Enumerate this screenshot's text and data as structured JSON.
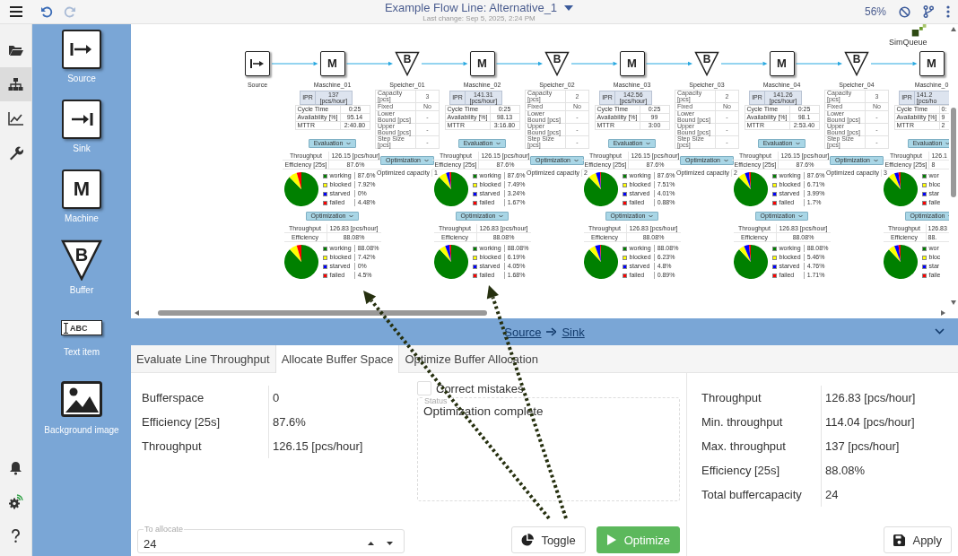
{
  "topbar": {
    "title": "Example Flow Line: Alternative_1",
    "subtitle": "Last change: Sep 5, 2025, 2:24 PM",
    "zoom": "56%"
  },
  "rail": {
    "top": [
      {
        "kind": "folder",
        "selected": false
      },
      {
        "kind": "sitemap",
        "selected": true
      },
      {
        "kind": "chart",
        "selected": false
      },
      {
        "kind": "wrench",
        "selected": false
      }
    ],
    "bottom": [
      {
        "kind": "bell"
      },
      {
        "kind": "gear"
      },
      {
        "kind": "help"
      }
    ]
  },
  "palette": [
    {
      "kind": "source",
      "label": "Source"
    },
    {
      "kind": "sink",
      "label": "Sink"
    },
    {
      "kind": "machine",
      "glyph": "M",
      "label": "Machine"
    },
    {
      "kind": "buffer",
      "glyph": "B",
      "label": "Buffer"
    },
    {
      "kind": "text",
      "glyph": "ABC",
      "label": "Text item"
    },
    {
      "kind": "image",
      "label": "Background image"
    }
  ],
  "canvas": {
    "logo": "SimQueue",
    "states": [
      {
        "color": "#008000"
      },
      {
        "color": "#ffff00"
      },
      {
        "color": "#0000ff"
      },
      {
        "color": "#ff0000"
      }
    ],
    "flow": [
      {
        "kind": "source",
        "name": "Source"
      },
      {
        "kind": "machine",
        "glyph": "M",
        "name": "Maschine_01",
        "ipr": {
          "label": "IPR",
          "value": "137 [pcs/hour]"
        },
        "params": [
          {
            "label": "Cycle Time",
            "value": "0:25"
          },
          {
            "label": "Availability [%]",
            "value": "95.14"
          },
          {
            "label": "MTTR",
            "value": "2:40.80"
          }
        ],
        "evaluation": {
          "label": "Evaluation",
          "rows": [
            {
              "label": "Throughput",
              "value": "126.15 [pcs/hour]"
            },
            {
              "label": "Efficiency [25s]",
              "value": "87.6%"
            }
          ],
          "chart_data": {
            "type": "pie",
            "categories": [
              "working",
              "blocked",
              "starved",
              "failed"
            ],
            "values": [
              87.6,
              7.92,
              0,
              4.48
            ],
            "value_labels": [
              "87.6%",
              "7.92%",
              "0%",
              "4.48%"
            ]
          }
        },
        "optimization": {
          "label": "Optimization",
          "rows": [
            {
              "label": "Throughput",
              "value": "126.83 [pcs/hour]"
            },
            {
              "label": "Efficiency",
              "value": "88.08%"
            }
          ],
          "chart_data": {
            "type": "pie",
            "categories": [
              "working",
              "blocked",
              "starved",
              "failed"
            ],
            "values": [
              88.08,
              7.42,
              0,
              4.5
            ],
            "value_labels": [
              "88.08%",
              "7.42%",
              "0%",
              "4.5%"
            ]
          }
        }
      },
      {
        "kind": "buffer",
        "glyph": "B",
        "name": "Speicher_01",
        "params": [
          {
            "label": "Capacity [pcs]",
            "value": "3"
          },
          {
            "label": "Fixed",
            "value": "No"
          },
          {
            "label": "Lower Bound [pcs]",
            "value": "-"
          },
          {
            "label": "Upper Bound [pcs]",
            "value": "-"
          },
          {
            "label": "Step Size [pcs]",
            "value": "-"
          }
        ],
        "optimization": {
          "label": "Optimization",
          "result_label": "Optimized capacity",
          "result": "1"
        }
      },
      {
        "kind": "machine",
        "glyph": "M",
        "name": "Maschine_02",
        "ipr": {
          "label": "IPR",
          "value": "141.31 [pcs/hour]"
        },
        "params": [
          {
            "label": "Cycle Time",
            "value": "0:25"
          },
          {
            "label": "Availability [%]",
            "value": "98.13"
          },
          {
            "label": "MTTR",
            "value": "3:16.80"
          }
        ],
        "evaluation": {
          "label": "Evaluation",
          "rows": [
            {
              "label": "Throughput",
              "value": "126.15 [pcs/hour]"
            },
            {
              "label": "Efficiency [25s]",
              "value": "87.6%"
            }
          ],
          "chart_data": {
            "type": "pie",
            "categories": [
              "working",
              "blocked",
              "starved",
              "failed"
            ],
            "values": [
              87.6,
              7.49,
              3.24,
              1.67
            ],
            "value_labels": [
              "87.6%",
              "7.49%",
              "3.24%",
              "1.67%"
            ]
          }
        },
        "optimization": {
          "label": "Optimization",
          "rows": [
            {
              "label": "Throughput",
              "value": "126.83 [pcs/hour]"
            },
            {
              "label": "Efficiency",
              "value": "88.08%"
            }
          ],
          "chart_data": {
            "type": "pie",
            "categories": [
              "working",
              "blocked",
              "starved",
              "failed"
            ],
            "values": [
              88.08,
              6.19,
              4.05,
              1.68
            ],
            "value_labels": [
              "88.08%",
              "6.19%",
              "4.05%",
              "1.68%"
            ]
          }
        }
      },
      {
        "kind": "buffer",
        "glyph": "B",
        "name": "Speicher_02",
        "params": [
          {
            "label": "Capacity [pcs]",
            "value": "2"
          },
          {
            "label": "Fixed",
            "value": "No"
          },
          {
            "label": "Lower Bound [pcs]",
            "value": "-"
          },
          {
            "label": "Upper Bound [pcs]",
            "value": "-"
          },
          {
            "label": "Step Size [pcs]",
            "value": "-"
          }
        ],
        "optimization": {
          "label": "Optimization",
          "result_label": "Optimized capacity",
          "result": "2"
        }
      },
      {
        "kind": "machine",
        "glyph": "M",
        "name": "Maschine_03",
        "ipr": {
          "label": "IPR",
          "value": "142.56 [pcs/hour]"
        },
        "params": [
          {
            "label": "Cycle Time",
            "value": "0:25"
          },
          {
            "label": "Availability [%]",
            "value": "99"
          },
          {
            "label": "MTTR",
            "value": "3:00"
          }
        ],
        "evaluation": {
          "label": "Evaluation",
          "rows": [
            {
              "label": "Throughput",
              "value": "126.15 [pcs/hour]"
            },
            {
              "label": "Efficiency [25s]",
              "value": "87.6%"
            }
          ],
          "chart_data": {
            "type": "pie",
            "categories": [
              "working",
              "blocked",
              "starved",
              "failed"
            ],
            "values": [
              87.6,
              7.51,
              4.01,
              0.88
            ],
            "value_labels": [
              "87.6%",
              "7.51%",
              "4.01%",
              "0.88%"
            ]
          }
        },
        "optimization": {
          "label": "Optimization",
          "rows": [
            {
              "label": "Throughput",
              "value": "126.83 [pcs/hour]"
            },
            {
              "label": "Efficiency",
              "value": "88.08%"
            }
          ],
          "chart_data": {
            "type": "pie",
            "categories": [
              "working",
              "blocked",
              "starved",
              "failed"
            ],
            "values": [
              88.08,
              6.23,
              4.8,
              0.89
            ],
            "value_labels": [
              "88.08%",
              "6.23%",
              "4.8%",
              "0.89%"
            ]
          }
        }
      },
      {
        "kind": "buffer",
        "glyph": "B",
        "name": "Speicher_03",
        "params": [
          {
            "label": "Capacity [pcs]",
            "value": "2"
          },
          {
            "label": "Fixed",
            "value": "No"
          },
          {
            "label": "Lower Bound [pcs]",
            "value": "-"
          },
          {
            "label": "Upper Bound [pcs]",
            "value": "-"
          },
          {
            "label": "Step Size [pcs]",
            "value": "-"
          }
        ],
        "optimization": {
          "label": "Optimization",
          "result_label": "Optimized capacity",
          "result": "2"
        }
      },
      {
        "kind": "machine",
        "glyph": "M",
        "name": "Maschine_04",
        "ipr": {
          "label": "IPR",
          "value": "141.26 [pcs/hour]"
        },
        "params": [
          {
            "label": "Cycle Time",
            "value": "0:25"
          },
          {
            "label": "Availability [%]",
            "value": "98.1"
          },
          {
            "label": "MTTR",
            "value": "2:53.40"
          }
        ],
        "evaluation": {
          "label": "Evaluation",
          "rows": [
            {
              "label": "Throughput",
              "value": "126.15 [pcs/hour]"
            },
            {
              "label": "Efficiency [25s]",
              "value": "87.6%"
            }
          ],
          "chart_data": {
            "type": "pie",
            "categories": [
              "working",
              "blocked",
              "starved",
              "failed"
            ],
            "values": [
              87.6,
              6.71,
              3.99,
              1.7
            ],
            "value_labels": [
              "87.6%",
              "6.71%",
              "3.99%",
              "1.7%"
            ]
          }
        },
        "optimization": {
          "label": "Optimization",
          "rows": [
            {
              "label": "Throughput",
              "value": "126.83 [pcs/hour]"
            },
            {
              "label": "Efficiency",
              "value": "88.08%"
            }
          ],
          "chart_data": {
            "type": "pie",
            "categories": [
              "working",
              "blocked",
              "starved",
              "failed"
            ],
            "values": [
              88.08,
              5.46,
              4.76,
              1.71
            ],
            "value_labels": [
              "88.08%",
              "5.46%",
              "4.76%",
              "1.71%"
            ]
          }
        }
      },
      {
        "kind": "buffer",
        "glyph": "B",
        "name": "Speicher_04",
        "params": [
          {
            "label": "Capacity [pcs]",
            "value": "3"
          },
          {
            "label": "Fixed",
            "value": "No"
          },
          {
            "label": "Lower Bound [pcs]",
            "value": "-"
          },
          {
            "label": "Upper Bound [pcs]",
            "value": "-"
          },
          {
            "label": "Step Size [pcs]",
            "value": "-"
          }
        ],
        "optimization": {
          "label": "Optimization",
          "result_label": "Optimized capacity",
          "result": "3"
        }
      },
      {
        "kind": "machine",
        "glyph": "M",
        "name": "Maschine_0",
        "ipr": {
          "label": "IPR",
          "value": "141.2 [pcs/ho"
        },
        "params": [
          {
            "label": "Cycle Time",
            "value": "0:"
          },
          {
            "label": "Availability [%]",
            "value": "9"
          },
          {
            "label": "MTTR",
            "value": "2"
          }
        ],
        "evaluation": {
          "label": "Evaluation",
          "rows": [
            {
              "label": "Throughput",
              "value": "126.1"
            },
            {
              "label": "Efficiency [25s]",
              "value": "8"
            }
          ],
          "legend": [
            "wor",
            "bloc",
            "star",
            "faile"
          ]
        },
        "optimization": {
          "label": "Optimization",
          "rows": [
            {
              "label": "Throughput",
              "value": "126.83"
            },
            {
              "label": "Efficiency",
              "value": "88."
            }
          ],
          "legend": [
            "wor",
            "bloc",
            "star",
            "faile"
          ]
        }
      }
    ]
  },
  "route": {
    "from": "Source",
    "to": "Sink"
  },
  "tabs": [
    {
      "label": "Evaluate Line Throughput",
      "selected": false
    },
    {
      "label": "Allocate Buffer Space",
      "selected": true
    },
    {
      "label": "Optimize Buffer Allocation",
      "selected": false
    }
  ],
  "allocate": {
    "rows": [
      {
        "label": "Bufferspace",
        "value": "0"
      },
      {
        "label": "Efficiency [25s]",
        "value": "87.6%"
      },
      {
        "label": "Throughput",
        "value": "126.15 [pcs/hour]"
      }
    ],
    "to_allocate": {
      "label": "To allocate",
      "value": "24"
    },
    "correct_mistakes": {
      "label": "Correct mistakes",
      "checked": false
    },
    "status": {
      "label": "Status",
      "value": "Optimization complete"
    },
    "buttons": [
      {
        "kind": "toggle",
        "label": "Toggle"
      },
      {
        "kind": "optimize",
        "label": "Optimize"
      }
    ],
    "results": [
      {
        "label": "Throughput",
        "value": "126.83 [pcs/hour]"
      },
      {
        "label": "Min. throughput",
        "value": "114.04 [pcs/hour]"
      },
      {
        "label": "Max. throughput",
        "value": "137 [pcs/hour]"
      },
      {
        "label": "Efficiency [25s]",
        "value": "88.08%"
      },
      {
        "label": "Total buffercapacity",
        "value": "24"
      }
    ],
    "apply": {
      "label": "Apply"
    }
  }
}
